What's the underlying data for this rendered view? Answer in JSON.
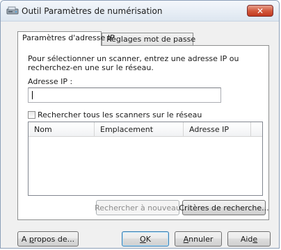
{
  "window": {
    "title": "Outil Paramètres de numérisation",
    "close_label": "✕"
  },
  "tabs": [
    {
      "label": "Paramètres d'adresse IP",
      "active": true
    },
    {
      "label": "Réglages mot de passe",
      "active": false
    }
  ],
  "panel": {
    "description": "Pour sélectionner un scanner, entrez une adresse IP ou recherchez-en une sur le réseau.",
    "ip_label": "Adresse IP :",
    "ip_value": "",
    "search_all_checkbox": {
      "label": "Rechercher tous les scanners sur le réseau",
      "checked": false
    },
    "list_columns": [
      "Nom",
      "Emplacement",
      "Adresse IP"
    ],
    "list_rows": [],
    "search_again_button": "Rechercher à nouveau",
    "search_criteria_button": "Critères de recherche..."
  },
  "footer": {
    "about_button": {
      "before": "A ",
      "underlined": "p",
      "after": "ropos de..."
    },
    "ok_button": {
      "before": "",
      "underlined": "O",
      "after": "K"
    },
    "cancel_button": {
      "before": "",
      "underlined": "A",
      "after": "nnuler"
    },
    "help_button": {
      "before": "Aid",
      "underlined": "e",
      "after": ""
    }
  }
}
